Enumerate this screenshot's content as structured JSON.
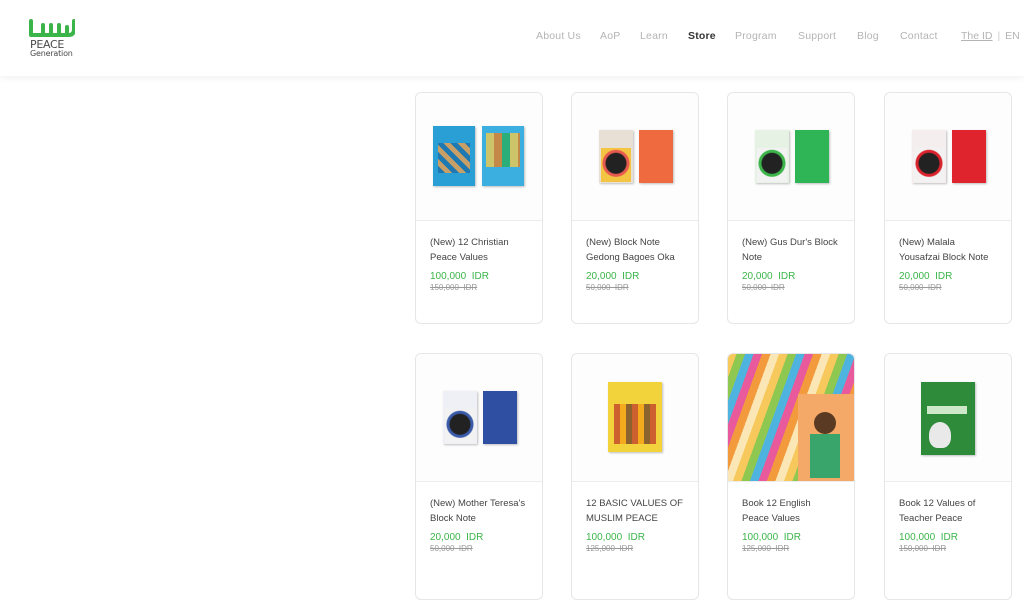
{
  "brand": {
    "name": "PEACE",
    "subname": "Generation"
  },
  "nav": {
    "items": [
      "About Us",
      "AoP",
      "Learn",
      "Store",
      "Program",
      "Support",
      "Blog",
      "Contact"
    ],
    "active": "Store"
  },
  "lang": {
    "current": "The ID",
    "separator": "|",
    "other": "EN"
  },
  "colors": {
    "brand_green": "#3bb54a",
    "text_muted": "#b4b4b4"
  },
  "products": [
    {
      "title": "(New) 12 Christian Peace Values",
      "price": "100,000  IDR",
      "old_price": "150,000  IDR"
    },
    {
      "title": "(New) Block Note Gedong Bagoes Oka",
      "price": "20,000  IDR",
      "old_price": "50,000  IDR"
    },
    {
      "title": "(New) Gus Dur's Block Note",
      "price": "20,000  IDR",
      "old_price": "50,000  IDR"
    },
    {
      "title": "(New) Malala Yousafzai Block Note",
      "price": "20,000  IDR",
      "old_price": "50,000  IDR"
    },
    {
      "title": "(New) Mother Teresa's Block Note",
      "price": "20,000  IDR",
      "old_price": "50,000  IDR"
    },
    {
      "title": "12 BASIC VALUES OF MUSLIM PEACE",
      "price": "100,000  IDR",
      "old_price": "125,000  IDR"
    },
    {
      "title": "Book 12 English Peace Values",
      "price": "100,000  IDR",
      "old_price": "125,000  IDR"
    },
    {
      "title": "Book 12 Values of Teacher Peace",
      "price": "100,000  IDR",
      "old_price": "150,000  IDR"
    }
  ]
}
